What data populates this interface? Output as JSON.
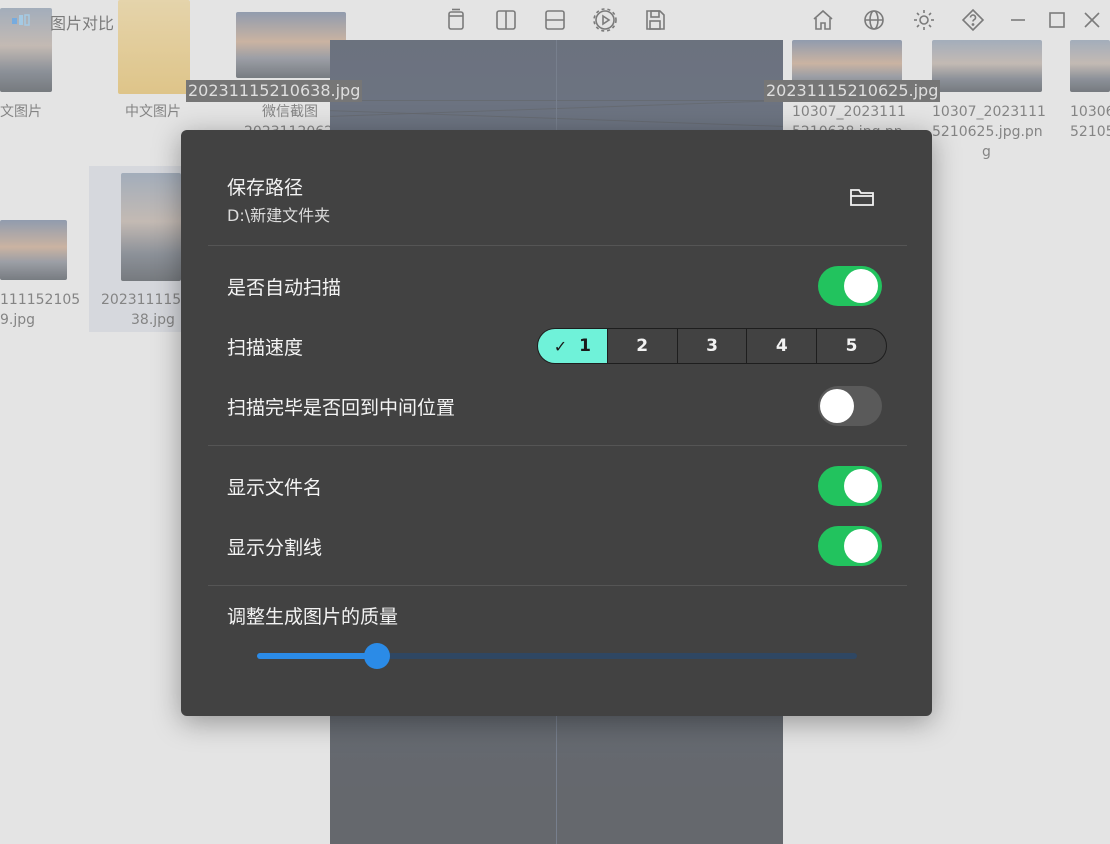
{
  "app": {
    "title": "图片对比"
  },
  "background_files": [
    {
      "label": "文图片"
    },
    {
      "label": "中文图片"
    },
    {
      "label": "微信截图"
    },
    {
      "label": "2023112062"
    },
    {
      "label": "10307_2023111"
    },
    {
      "label": "5210638.jpg.pn"
    },
    {
      "label": "10307_2023111"
    },
    {
      "label": "5210625.jpg.pn"
    },
    {
      "label": "g"
    },
    {
      "label": "10306"
    },
    {
      "label": "52105"
    },
    {
      "label": "111152105"
    },
    {
      "label": "9.jpg"
    },
    {
      "label": "2023111152"
    },
    {
      "label": "38.jpg"
    }
  ],
  "image_names": {
    "left": "20231115210638.jpg",
    "right": "20231115210625.jpg"
  },
  "settings": {
    "save_path_title": "保存路径",
    "save_path_value": "D:\\新建文件夹",
    "auto_scan_label": "是否自动扫描",
    "auto_scan_on": true,
    "scan_speed_label": "扫描速度",
    "scan_speed_options": [
      "1",
      "2",
      "3",
      "4",
      "5"
    ],
    "scan_speed_selected": "1",
    "return_center_label": "扫描完毕是否回到中间位置",
    "return_center_on": false,
    "show_filename_label": "显示文件名",
    "show_filename_on": true,
    "show_divider_label": "显示分割线",
    "show_divider_on": true,
    "quality_label": "调整生成图片的质量",
    "quality_fraction": 0.2
  },
  "colors": {
    "toggle_on": "#22c35e",
    "selected_speed": "#6ff2d9",
    "slider_accent": "#2b8be7",
    "dialog_bg": "#424242"
  }
}
